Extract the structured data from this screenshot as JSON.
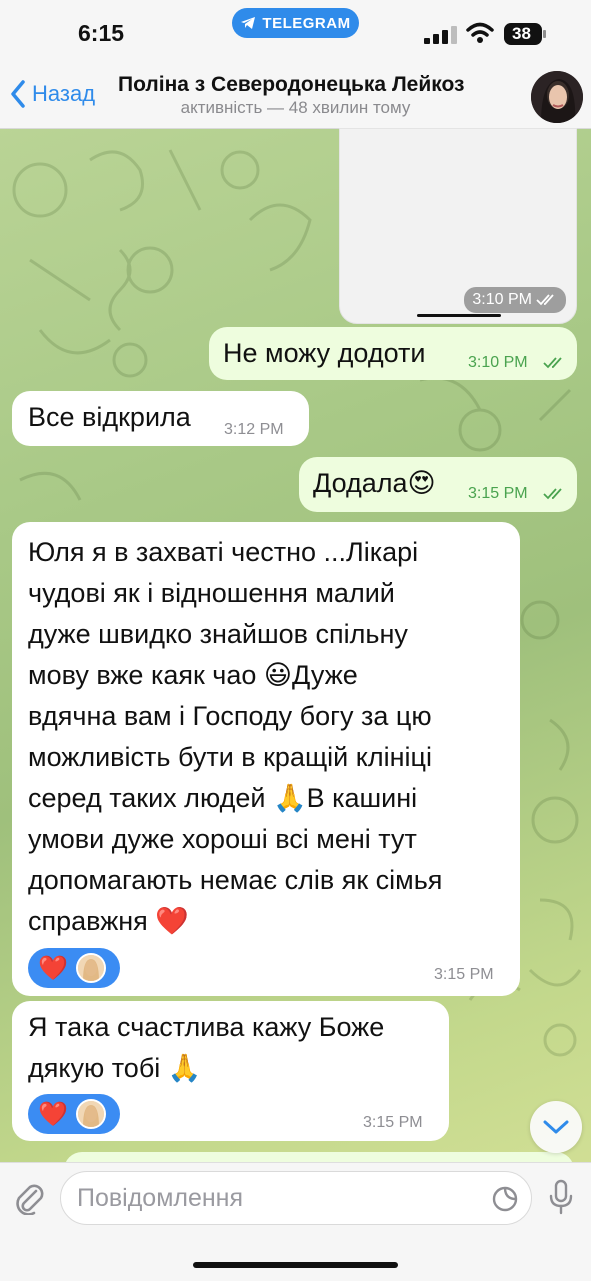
{
  "status_bar": {
    "time": "6:15",
    "app_pill": "TELEGRAM",
    "battery": "38"
  },
  "header": {
    "back_label": "Назад",
    "title": "Поліна з Северодонецька Лейкоз",
    "status": "активність — 48 хвилин тому"
  },
  "messages": [
    {
      "type": "media",
      "direction": "out",
      "time": "3:10 PM",
      "read": true
    },
    {
      "type": "text",
      "direction": "out",
      "text": "Не можу додоти",
      "time": "3:10 PM",
      "read": true
    },
    {
      "type": "text",
      "direction": "in",
      "text": "Все відкрила",
      "time": "3:12 PM"
    },
    {
      "type": "text",
      "direction": "out",
      "text": "Додала😍",
      "time": "3:15 PM",
      "read": true
    },
    {
      "type": "text",
      "direction": "in",
      "lines": [
        "Юля я в захваті честно ...Лікарі",
        "чудові як і відношення малий",
        "дуже швидко знайшов спільну",
        "мову вже каяк чао 😃Дуже",
        "вдячна вам і Господу богу за цю",
        "можливість бути в кращій клініці",
        "серед таких людей 🙏В кашині",
        "умови дуже хороші всі мені тут",
        "допомагають немає слів як сімья",
        "справжня ❤️"
      ],
      "time": "3:15 PM",
      "reaction": "❤️"
    },
    {
      "type": "text",
      "direction": "in",
      "lines": [
        "Я така счастлива кажу Боже",
        "дякую тобі 🙏"
      ],
      "time": "3:15 PM",
      "reaction": "❤️"
    }
  ],
  "input": {
    "placeholder": "Повідомлення"
  },
  "colors": {
    "accent": "#2f8bea",
    "outgoing_bubble": "#eefdde",
    "incoming_bubble": "#ffffff",
    "reaction": "#3b8cf3"
  }
}
